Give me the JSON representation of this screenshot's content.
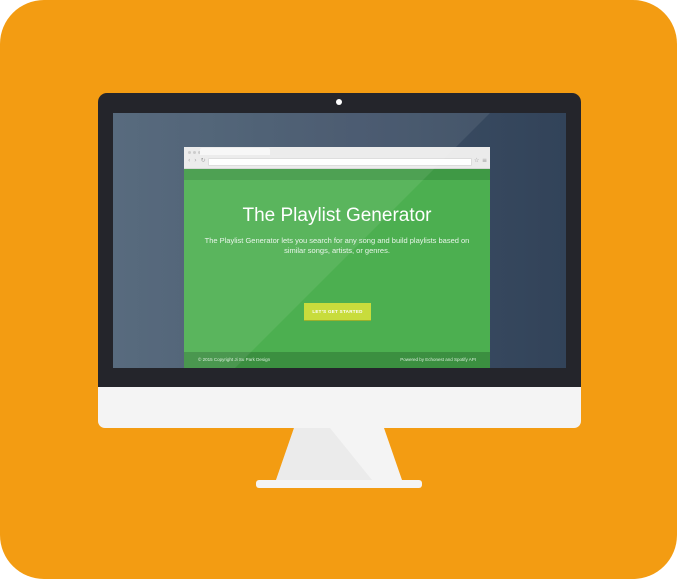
{
  "colors": {
    "background_tile": "#f39c12",
    "bezel": "#24252b",
    "screen": "#3e5067",
    "site_green": "#4caf50",
    "site_nav_green": "#3f9945",
    "footer_green": "#3b8f40",
    "cta_yellow_green": "#c8dc3c",
    "monitor_white": "#f4f4f4"
  },
  "icons": {
    "camera": "camera-dot",
    "browser_nav": "back-forward-refresh",
    "browser_menu": "menu-lines"
  },
  "browser": {
    "nav_glyphs": "‹ › ↻",
    "menu_glyph": "≡",
    "star_glyph": "☆"
  },
  "hero": {
    "title": "The Playlist Generator",
    "description": "The Playlist Generator lets you search for any song and build playlists based on similar songs, artists, or genres.",
    "cta_label": "LET'S GET STARTED"
  },
  "footer": {
    "left": "© 2015 Copyright Ji Su Park Design",
    "right": "Powered by Echonest and Spotify API"
  }
}
